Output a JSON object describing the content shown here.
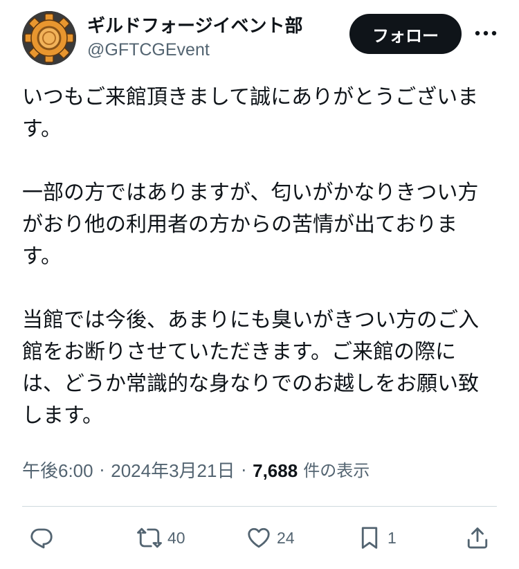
{
  "author": {
    "display_name": "ギルドフォージイベント部",
    "handle": "@GFTCGEvent",
    "avatar_icon": "gear-logo-icon"
  },
  "follow_label": "フォロー",
  "more_icon": "more-dots-icon",
  "tweet": {
    "paragraphs": [
      "いつもご来館頂きまして誠にありがとうございま\nす。",
      "一部の方ではありますが、匂いがかなりきつい方\nがおり他の利用者の方からの苦情が出ておりま\nす。",
      "当館では今後、あまりにも臭いがきつい方のご入\n館をお断りさせていただきます。ご来館の際に\nは、どうか常識的な身なりでのお越しをお願い致\nします。"
    ]
  },
  "meta": {
    "time": "午後6:00",
    "date": "2024年3月21日",
    "views_count": "7,688",
    "views_label": "件の表示"
  },
  "actions": {
    "reply": {
      "icon": "reply-icon",
      "count": ""
    },
    "retweet": {
      "icon": "retweet-icon",
      "count": "40"
    },
    "like": {
      "icon": "heart-icon",
      "count": "24"
    },
    "bookmark": {
      "icon": "bookmark-icon",
      "count": "1"
    },
    "share": {
      "icon": "share-icon",
      "count": ""
    }
  },
  "colors": {
    "text": "#0f1419",
    "secondary": "#536471",
    "follow_bg": "#0f1419",
    "divider": "#cfd9de",
    "avatar_accent": "#e8962f"
  }
}
